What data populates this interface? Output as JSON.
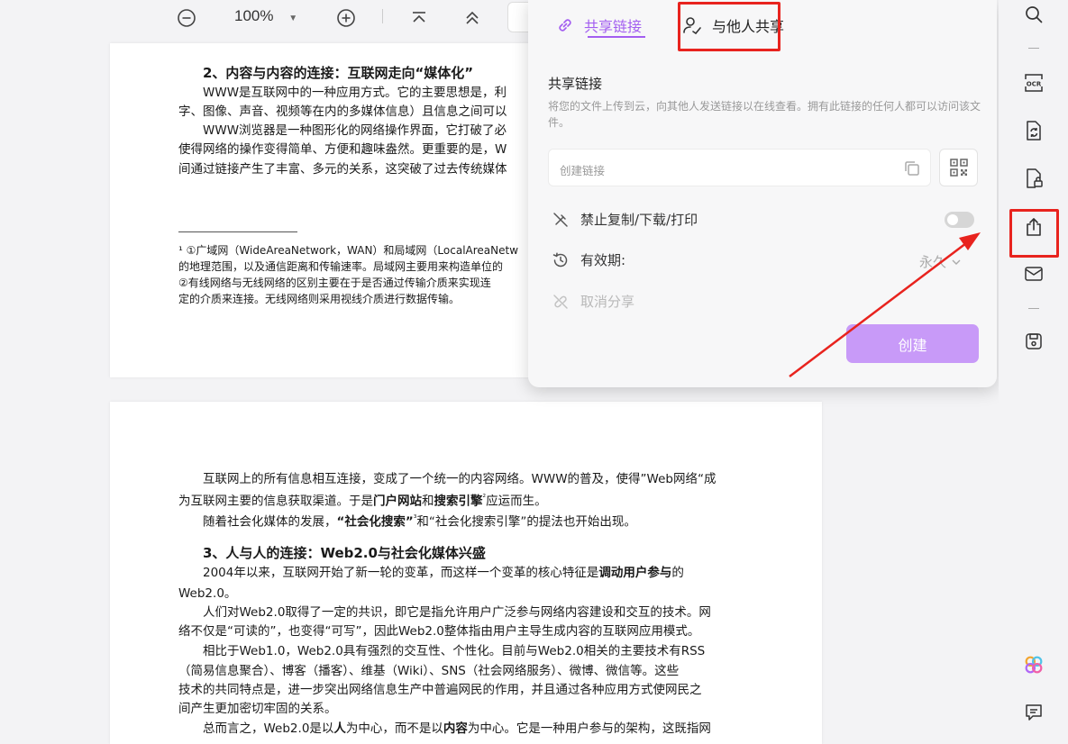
{
  "toolbar": {
    "zoom_value": "100%"
  },
  "share_panel": {
    "tabs": [
      {
        "label": "共享链接",
        "active": true
      },
      {
        "label": "与他人共享",
        "active": false
      }
    ],
    "section_title": "共享链接",
    "description": "将您的文件上传到云，向其他人发送链接以在线查看。拥有此链接的任何人都可以访问该文件。",
    "link_input_placeholder": "创建链接",
    "options": {
      "disable_copy_label": "禁止复制/下载/打印",
      "disable_copy_enabled": false,
      "validity_label": "有效期:",
      "validity_value": "永久",
      "cancel_share_label": "取消分享"
    },
    "create_button": "创建",
    "accent_color": "#a35ef0",
    "highlight_color": "#e8231e"
  },
  "page1": {
    "heading": "2、内容与内容的连接：互联网走向“媒体化”",
    "paragraphs": [
      "WWW是互联网中的一种应用方式。它的主要思想是，利",
      "字、图像、声音、视频等在内的多媒体信息）且信息之间可以",
      "WWW浏览器是一种图形化的网络操作界面，它打破了必",
      "使得网络的操作变得简单、方便和趣味盎然。更重要的是，W",
      "间通过链接产生了丰富、多元的关系，这突破了过去传统媒体"
    ],
    "footnotes": [
      "¹ ①广域网（WideAreaNetwork，WAN）和局域网（LocalAreaNetw",
      "的地理范围，以及通信距离和传输速率。局域网主要用来构造单位的",
      "②有线网络与无线网络的区别主要在于是否通过传输介质来实现连",
      "定的介质来连接。无线网络则采用视线介质进行数据传输。"
    ]
  },
  "page2": {
    "p1": [
      "互联网上的所有信息相互连接，变成了一个统一的内容网络。WWW的普及，使得”Web网络“成",
      "为互联网主要的信息获取渠道。于是"
    ],
    "p1_portal": "门户网站",
    "p1_and": "和",
    "p1_search": "搜索引擎",
    "p1_sup": "²",
    "p1_end": "应运而生。",
    "p2_start": "随着社会化媒体的发展，",
    "p2_bold": "“社会化搜索”",
    "p2_sup": "³",
    "p2_end": "和“社会化搜索引擎”的提法也开始出现。",
    "heading": "3、人与人的连接：Web2.0与社会化媒体兴盛",
    "p3_start": "2004年以来，互联网开始了新一轮的变革，而这样一个变革的核心特征是",
    "p3_bold": "调动用户参与",
    "p3_end": "的",
    "p3_line2": "Web2.0。",
    "p4": [
      "人们对Web2.0取得了一定的共识，即它是指允许用户广泛参与网络内容建设和交互的技术。网",
      "络不仅是“可读的”，也变得“可写”，因此Web2.0整体指由用户主导生成内容的互联网应用模式。"
    ],
    "p5": [
      "相比于Web1.0，Web2.0具有强烈的交互性、个性化。目前与Web2.0相关的主要技术有RSS",
      "（简易信息聚合）、博客（播客）、维基（Wiki）、SNS（社会网络服务）、微博、微信等。这些",
      "技术的共同特点是，进一步突出网络信息生产中普遍网民的作用，并且通过各种应用方式使网民之",
      "间产生更加密切牢固的关系。"
    ],
    "p6_start": "总而言之，Web2.0是以",
    "p6_bold1": "人",
    "p6_mid": "为中心，而不是以",
    "p6_bold2": "内容",
    "p6_end": "为中心。它是一种用户参与的架构，这既指网"
  }
}
